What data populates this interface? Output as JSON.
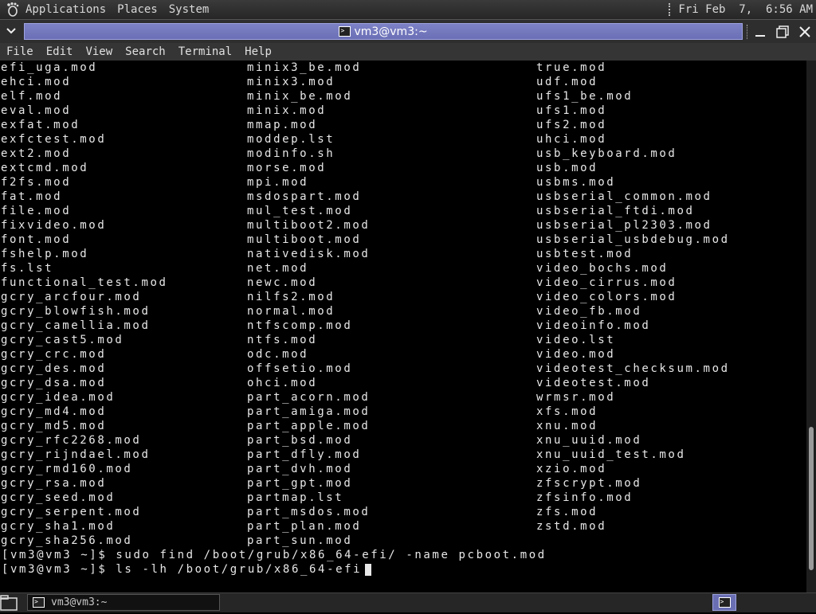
{
  "top_panel": {
    "menus": [
      "Applications",
      "Places",
      "System"
    ],
    "clock": "Fri Feb  7,  6:56 AM",
    "icons": {
      "logo": "gnome-foot-icon"
    }
  },
  "window": {
    "title": "vm3@vm3:~",
    "controls": [
      "minimize",
      "maximize",
      "close"
    ]
  },
  "term_menu": [
    "File",
    "Edit",
    "View",
    "Search",
    "Terminal",
    "Help"
  ],
  "listing": [
    [
      "efi_uga.mod",
      "minix3_be.mod",
      "true.mod"
    ],
    [
      "ehci.mod",
      "minix3.mod",
      "udf.mod"
    ],
    [
      "elf.mod",
      "minix_be.mod",
      "ufs1_be.mod"
    ],
    [
      "eval.mod",
      "minix.mod",
      "ufs1.mod"
    ],
    [
      "exfat.mod",
      "mmap.mod",
      "ufs2.mod"
    ],
    [
      "exfctest.mod",
      "moddep.lst",
      "uhci.mod"
    ],
    [
      "ext2.mod",
      "modinfo.sh",
      "usb_keyboard.mod"
    ],
    [
      "extcmd.mod",
      "morse.mod",
      "usb.mod"
    ],
    [
      "f2fs.mod",
      "mpi.mod",
      "usbms.mod"
    ],
    [
      "fat.mod",
      "msdospart.mod",
      "usbserial_common.mod"
    ],
    [
      "file.mod",
      "mul_test.mod",
      "usbserial_ftdi.mod"
    ],
    [
      "fixvideo.mod",
      "multiboot2.mod",
      "usbserial_pl2303.mod"
    ],
    [
      "font.mod",
      "multiboot.mod",
      "usbserial_usbdebug.mod"
    ],
    [
      "fshelp.mod",
      "nativedisk.mod",
      "usbtest.mod"
    ],
    [
      "fs.lst",
      "net.mod",
      "video_bochs.mod"
    ],
    [
      "functional_test.mod",
      "newc.mod",
      "video_cirrus.mod"
    ],
    [
      "gcry_arcfour.mod",
      "nilfs2.mod",
      "video_colors.mod"
    ],
    [
      "gcry_blowfish.mod",
      "normal.mod",
      "video_fb.mod"
    ],
    [
      "gcry_camellia.mod",
      "ntfscomp.mod",
      "videoinfo.mod"
    ],
    [
      "gcry_cast5.mod",
      "ntfs.mod",
      "video.lst"
    ],
    [
      "gcry_crc.mod",
      "odc.mod",
      "video.mod"
    ],
    [
      "gcry_des.mod",
      "offsetio.mod",
      "videotest_checksum.mod"
    ],
    [
      "gcry_dsa.mod",
      "ohci.mod",
      "videotest.mod"
    ],
    [
      "gcry_idea.mod",
      "part_acorn.mod",
      "wrmsr.mod"
    ],
    [
      "gcry_md4.mod",
      "part_amiga.mod",
      "xfs.mod"
    ],
    [
      "gcry_md5.mod",
      "part_apple.mod",
      "xnu.mod"
    ],
    [
      "gcry_rfc2268.mod",
      "part_bsd.mod",
      "xnu_uuid.mod"
    ],
    [
      "gcry_rijndael.mod",
      "part_dfly.mod",
      "xnu_uuid_test.mod"
    ],
    [
      "gcry_rmd160.mod",
      "part_dvh.mod",
      "xzio.mod"
    ],
    [
      "gcry_rsa.mod",
      "part_gpt.mod",
      "zfscrypt.mod"
    ],
    [
      "gcry_seed.mod",
      "partmap.lst",
      "zfsinfo.mod"
    ],
    [
      "gcry_serpent.mod",
      "part_msdos.mod",
      "zfs.mod"
    ],
    [
      "gcry_sha1.mod",
      "part_plan.mod",
      "zstd.mod"
    ],
    [
      "gcry_sha256.mod",
      "part_sun.mod",
      ""
    ]
  ],
  "commands": [
    {
      "prompt": "[vm3@vm3 ~]$",
      "command": "sudo find /boot/grub/x86_64-efi/ -name pcboot.mod"
    },
    {
      "prompt": "[vm3@vm3 ~]$",
      "command": "ls -lh /boot/grub/x86_64-efi"
    }
  ],
  "scrollbar": {
    "position_fraction": 0.7,
    "visible_fraction": 0.27
  },
  "bottom_panel": {
    "task_label": "vm3@vm3:~"
  },
  "colors": {
    "title_accent": "#7478bd",
    "terminal_bg": "#000000",
    "terminal_fg": "#e8e8e8"
  }
}
